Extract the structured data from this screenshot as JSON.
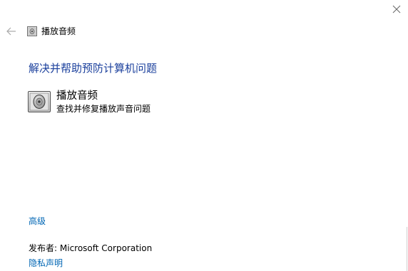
{
  "window": {
    "close_icon": "close-icon"
  },
  "header": {
    "back_icon": "back-arrow-icon",
    "title_icon": "speaker-icon",
    "title": "播放音频"
  },
  "main": {
    "heading": "解决并帮助预防计算机问题",
    "troubleshooter": {
      "icon": "speaker-icon",
      "title": "播放音频",
      "description": "查找并修复播放声音问题"
    }
  },
  "footer": {
    "advanced_label": "高级",
    "publisher_label": "发布者:",
    "publisher_name": "Microsoft Corporation",
    "privacy_label": "隐私声明"
  },
  "colors": {
    "heading": "#1a3f9c",
    "link": "#0066b4",
    "background": "#ffffff"
  }
}
